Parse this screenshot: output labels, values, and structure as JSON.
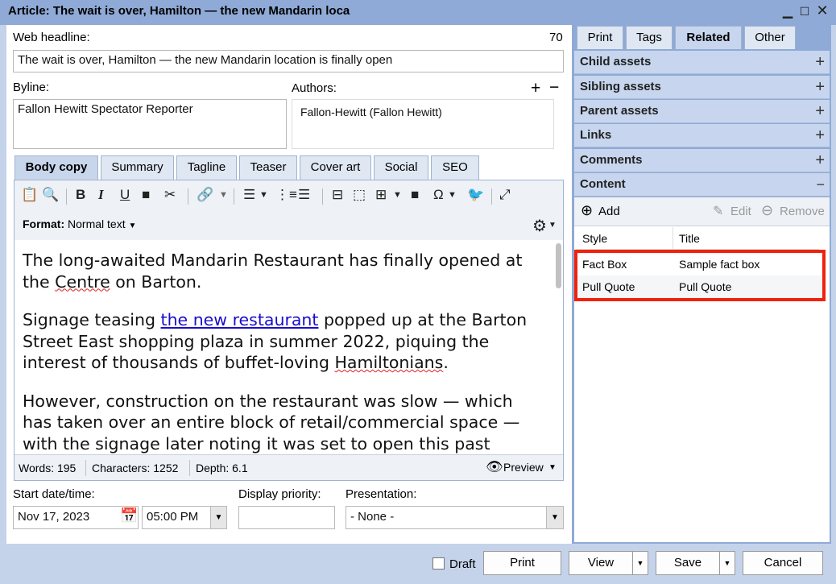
{
  "window": {
    "title": "Article: The wait is over, Hamilton — the new Mandarin loca"
  },
  "form": {
    "headline_label": "Web headline:",
    "headline_count": "70",
    "headline_value": "The wait is over, Hamilton — the new Mandarin location is finally open",
    "byline_label": "Byline:",
    "byline_value": "Fallon Hewitt Spectator Reporter",
    "authors_label": "Authors:",
    "authors_value": "Fallon-Hewitt (Fallon Hewitt)"
  },
  "content_tabs": [
    "Body copy",
    "Summary",
    "Tagline",
    "Teaser",
    "Cover art",
    "Social",
    "SEO"
  ],
  "editor": {
    "format_label": "Format:",
    "format_value": "Normal text",
    "p1_a": "The long-awaited Mandarin Restaurant has finally opened at the ",
    "p1_b": "Centre",
    "p1_c": " on Barton.",
    "p2_a": "Signage teasing ",
    "p2_link": "the new restaurant",
    "p2_b": " popped up at the Barton Street East shopping plaza in summer 2022, piquing the interest of thousands of buffet-loving ",
    "p2_c": "Hamiltonians",
    "p2_d": ".",
    "p3": "However, construction on the restaurant was slow — which has taken over an entire block of retail/commercial space — with the signage later noting it was set to open this past"
  },
  "status": {
    "words": "Words: 195",
    "characters": "Characters: 1252",
    "depth": "Depth: 6.1",
    "preview": "Preview"
  },
  "schedule": {
    "start_label": "Start date/time:",
    "date_value": "Nov 17, 2023",
    "time_value": "05:00 PM",
    "priority_label": "Display priority:",
    "priority_value": "",
    "presentation_label": "Presentation:",
    "presentation_value": "- None -"
  },
  "side_tabs": [
    "Print",
    "Tags",
    "Related",
    "Other"
  ],
  "sections": [
    "Child assets",
    "Sibling assets",
    "Parent assets",
    "Links",
    "Comments"
  ],
  "content": {
    "header": "Content",
    "add": "Add",
    "edit": "Edit",
    "remove": "Remove",
    "col_style": "Style",
    "col_title": "Title",
    "rows": [
      {
        "style": "Fact Box",
        "title": "Sample fact box"
      },
      {
        "style": "Pull Quote",
        "title": "Pull Quote"
      }
    ]
  },
  "footer": {
    "draft": "Draft",
    "print": "Print",
    "view": "View",
    "save": "Save",
    "cancel": "Cancel"
  }
}
